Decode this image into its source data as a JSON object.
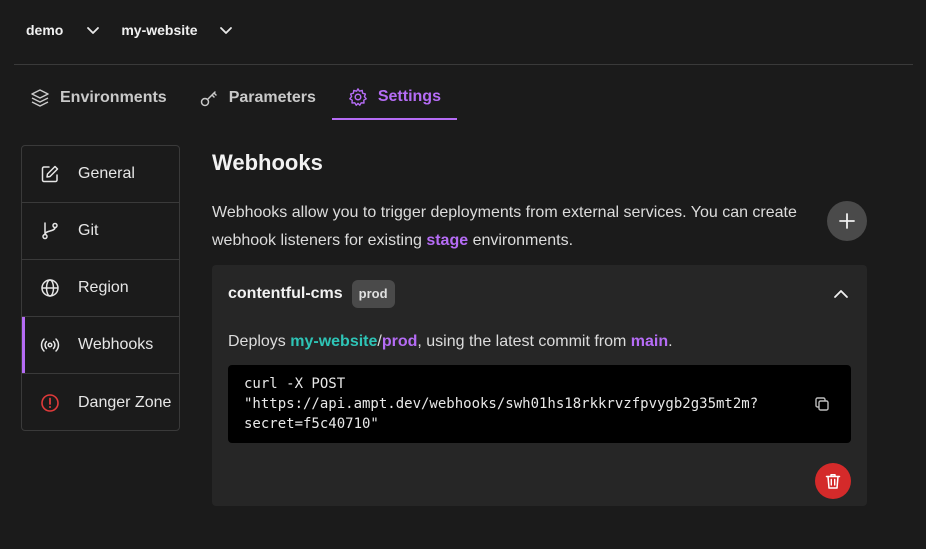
{
  "breadcrumb": {
    "org": "demo",
    "app": "my-website"
  },
  "tabs": [
    {
      "label": "Environments",
      "icon": "layers-icon"
    },
    {
      "label": "Parameters",
      "icon": "key-icon"
    },
    {
      "label": "Settings",
      "icon": "gear-icon"
    }
  ],
  "sidebar": {
    "items": [
      {
        "label": "General",
        "icon": "edit-icon"
      },
      {
        "label": "Git",
        "icon": "git-branch-icon"
      },
      {
        "label": "Region",
        "icon": "globe-icon"
      },
      {
        "label": "Webhooks",
        "icon": "broadcast-icon"
      },
      {
        "label": "Danger Zone",
        "icon": "alert-circle-icon"
      }
    ]
  },
  "main": {
    "title": "Webhooks",
    "description_pre": "Webhooks allow you to trigger deployments from external services. You can create webhook listeners for existing ",
    "description_highlight": "stage",
    "description_post": " environments."
  },
  "webhook": {
    "name": "contentful-cms",
    "env": "prod",
    "deploys_prefix": "Deploys ",
    "app": "my-website",
    "separator": "/",
    "env_link": "prod",
    "deploys_mid": ", using the latest commit from ",
    "branch": "main",
    "deploys_end": ".",
    "code_lines": [
      "curl -X POST",
      "\"https://api.ampt.dev/webhooks/swh01hs18rkkrvzfpvygb2g35mt2m?",
      "secret=f5c40710\""
    ]
  },
  "colors": {
    "accent": "#b56cf5",
    "teal": "#2ec4b6",
    "danger": "#d42a2a",
    "background": "#1b1b1b"
  }
}
